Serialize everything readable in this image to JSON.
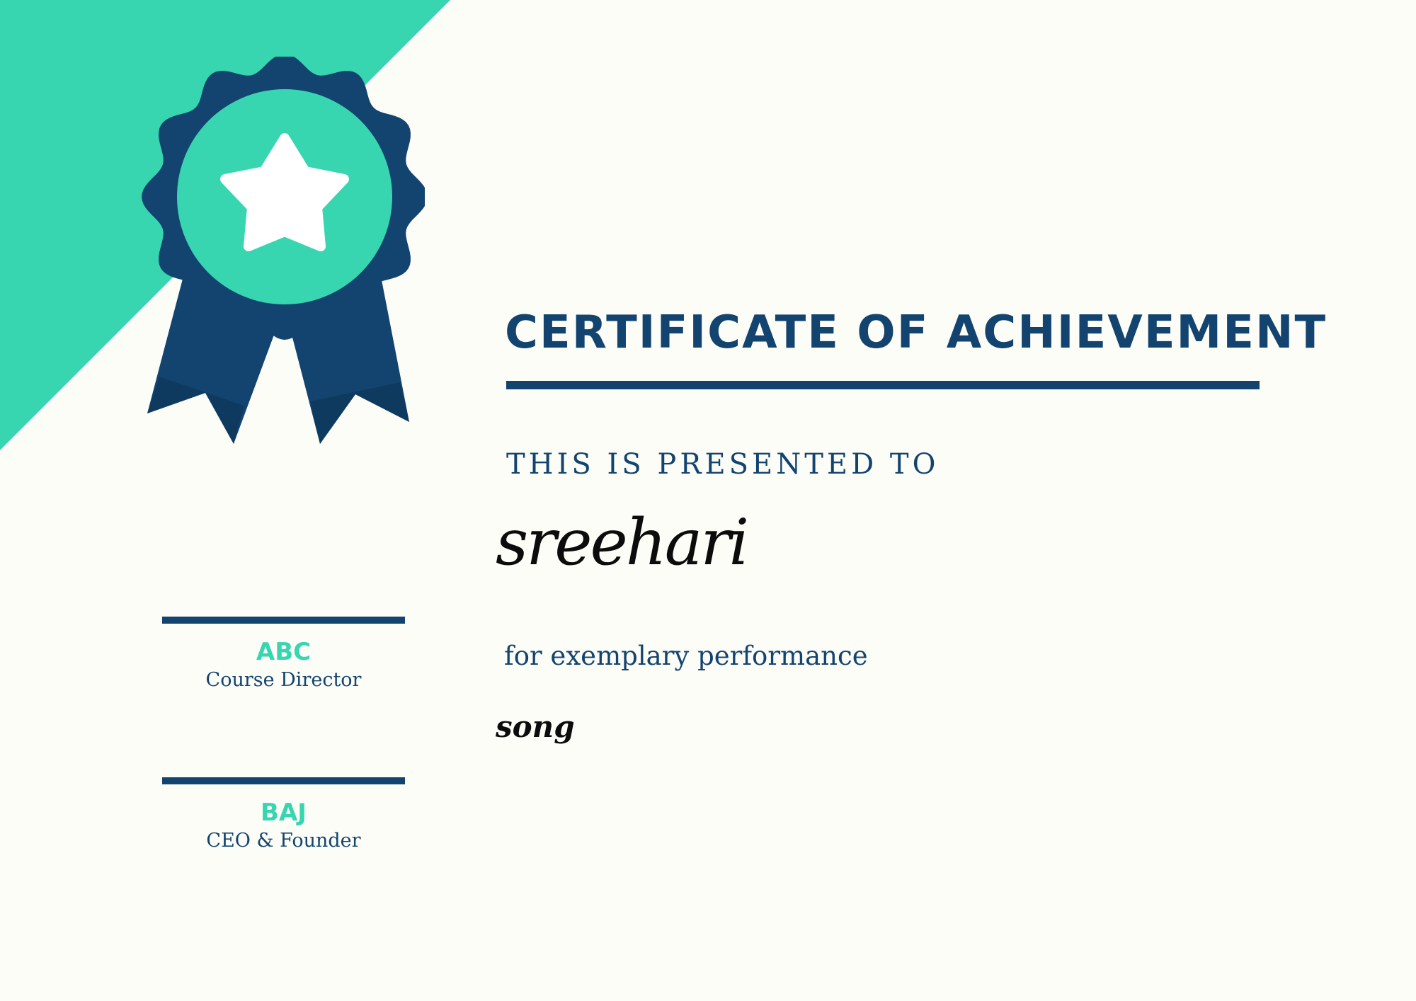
{
  "colors": {
    "accent": "#38d6b0",
    "navy": "#134470",
    "background": "#fdfdf7",
    "name_text": "#0c0c0c"
  },
  "badge": {
    "icon": "ribbon-award-badge-with-star"
  },
  "certificate": {
    "title": "CERTIFICATE OF ACHIEVEMENT",
    "presented_label": "THIS IS PRESENTED TO",
    "recipient_name": "sreehari",
    "reason": "for exemplary performance",
    "detail": "song"
  },
  "signatories": [
    {
      "name": "ABC",
      "role": "Course Director"
    },
    {
      "name": "BAJ",
      "role": "CEO & Founder"
    }
  ]
}
